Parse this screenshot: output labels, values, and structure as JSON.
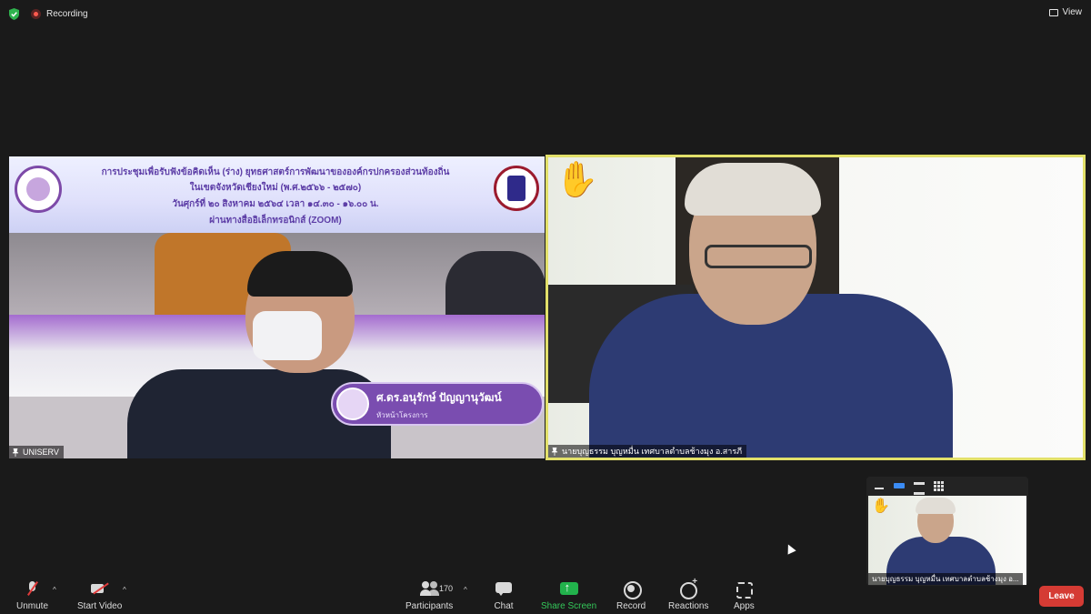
{
  "topbar": {
    "recording_label": "Recording",
    "view_label": "View"
  },
  "tile1": {
    "banner_lines": [
      "การประชุมเพื่อรับฟังข้อคิดเห็น (ร่าง) ยุทธศาสตร์การพัฒนาขององค์กรปกครองส่วนท้องถิ่น",
      "ในเขตจังหวัดเชียงใหม่ (พ.ศ.๒๕๖๖ - ๒๕๗๐)",
      "วันศุกร์ที่ ๒๐ สิงหาคม ๒๕๖๔ เวลา ๑๔.๓๐ - ๑๖.๐๐ น.",
      "ผ่านทางสื่ออิเล็กทรอนิกส์ (ZOOM)"
    ],
    "nameplate_name": "ศ.ดร.อนุรักษ์ ปัญญานุวัฒน์",
    "nameplate_role": "หัวหน้าโครงการ",
    "participant_name": "UNISERV"
  },
  "tile2": {
    "participant_name": "นายบุญธรรม บุญหมื่น เทศบาลตำบลช้างมุง อ.สารภี",
    "raised_hand": "✋"
  },
  "selfview": {
    "participant_name": "นายบุญธรรม บุญหมื่น เทศบาลตำบลช้างมุง อ...",
    "raised_hand": "✋"
  },
  "toolbar": {
    "unmute_label": "Unmute",
    "start_video_label": "Start Video",
    "participants_label": "Participants",
    "participants_count": "170",
    "chat_label": "Chat",
    "share_screen_label": "Share Screen",
    "record_label": "Record",
    "reactions_label": "Reactions",
    "apps_label": "Apps",
    "leave_label": "Leave",
    "caret": "^"
  },
  "colors": {
    "active_speaker_border": "#e2e06a",
    "share_green": "#22b24c",
    "leave_red": "#d53b34",
    "record_dot": "#ff5a4f"
  }
}
